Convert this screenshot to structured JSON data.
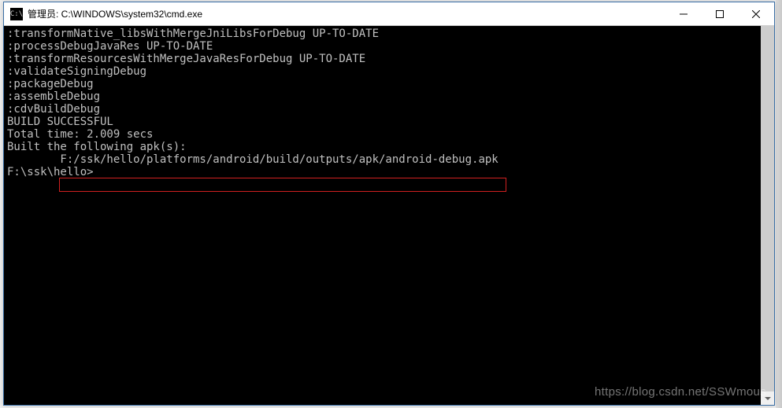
{
  "window": {
    "title": "管理员: C:\\WINDOWS\\system32\\cmd.exe",
    "icon_label": "C:\\"
  },
  "terminal": {
    "lines": [
      ":transformNative_libsWithMergeJniLibsForDebug UP-TO-DATE",
      ":processDebugJavaRes UP-TO-DATE",
      ":transformResourcesWithMergeJavaResForDebug UP-TO-DATE",
      ":validateSigningDebug",
      ":packageDebug",
      ":assembleDebug",
      ":cdvBuildDebug",
      "",
      "BUILD SUCCESSFUL",
      "",
      "Total time: 2.009 secs",
      "Built the following apk(s):",
      "        F:/ssk/hello/platforms/android/build/outputs/apk/android-debug.apk",
      "",
      "F:\\ssk\\hello>"
    ],
    "highlighted_path": "F:/ssk/hello/platforms/android/build/outputs/apk/android-debug.apk"
  },
  "watermark": "https://blog.csdn.net/SSWmous"
}
